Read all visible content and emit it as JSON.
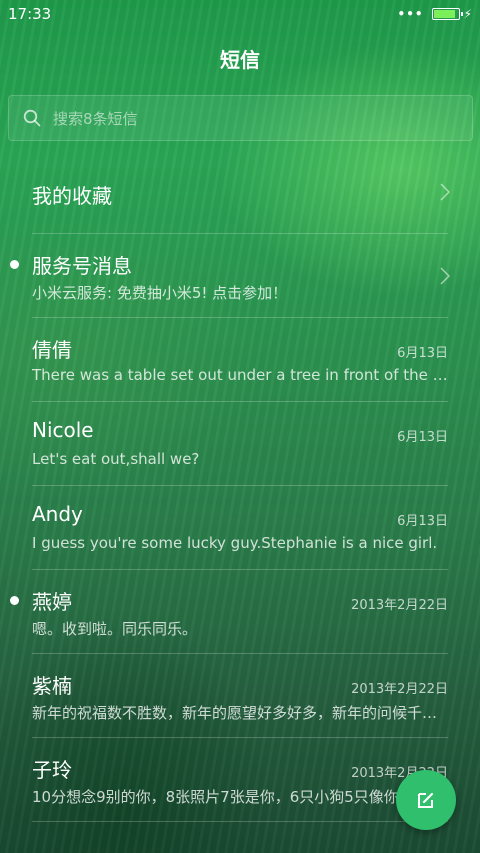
{
  "status_bar": {
    "time": "17:33",
    "signal_dots": "•••",
    "battery_level": 0.95,
    "charging": true
  },
  "header": {
    "title": "短信"
  },
  "search": {
    "placeholder": "搜索8条短信"
  },
  "favorites": {
    "label": "我的收藏"
  },
  "conversations": [
    {
      "name": "服务号消息",
      "date": "",
      "preview": "小米云服务: 免费抽小米5! 点击参加！",
      "unread": true,
      "has_chevron": true
    },
    {
      "name": "倩倩",
      "date": "6月13日",
      "preview": "There was a table set out under a tree in front of the house, and the March Hare and the Hatter were having tea at it",
      "unread": false
    },
    {
      "name": "Nicole",
      "date": "6月13日",
      "preview": "Let's eat out,shall we?",
      "unread": false
    },
    {
      "name": "Andy",
      "date": "6月13日",
      "preview": "I guess you're some lucky guy.Stephanie is a nice girl.",
      "unread": false
    },
    {
      "name": "燕婷",
      "date": "2013年2月22日",
      "preview": "嗯。收到啦。同乐同乐。",
      "unread": true
    },
    {
      "name": "紫楠",
      "date": "2013年2月22日",
      "preview": "新年的祝福数不胜数，新年的愿望好多好多，新年的问候千言万语",
      "unread": false
    },
    {
      "name": "子玲",
      "date": "2013年2月22日",
      "preview": "10分想念9别的你，8张照片7张是你，6只小狗5只像你",
      "unread": false
    }
  ],
  "icons": {
    "search": "search-icon",
    "chevron": "chevron-right-icon",
    "compose": "compose-icon"
  },
  "colors": {
    "fab": "#2fbf6d",
    "battery": "#7cf05a"
  }
}
